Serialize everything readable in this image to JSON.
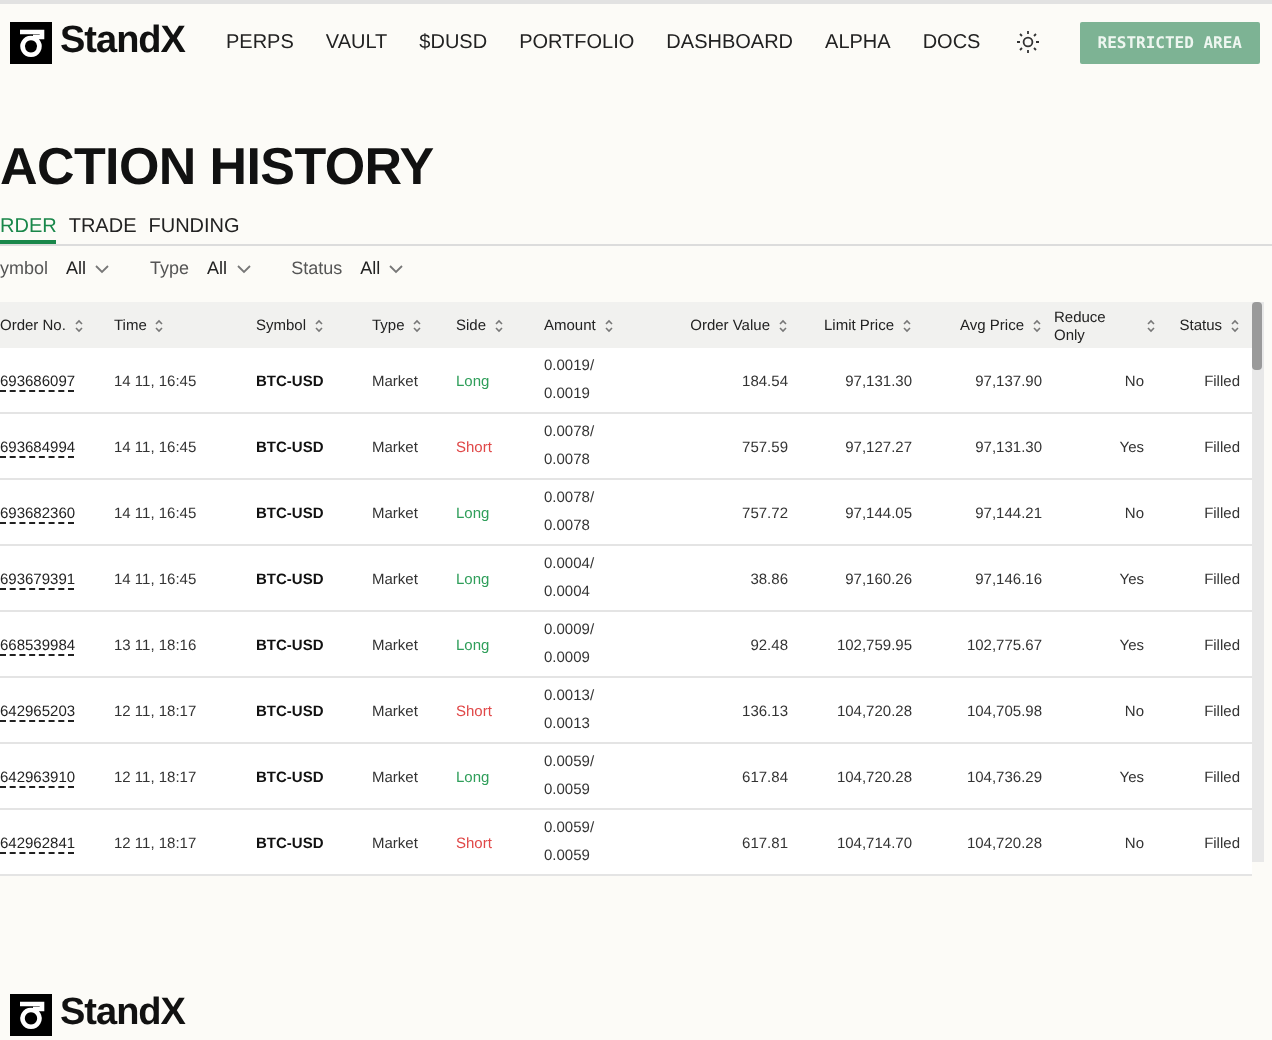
{
  "brand": {
    "name": "StandX"
  },
  "nav": [
    "PERPS",
    "VAULT",
    "$DUSD",
    "PORTFOLIO",
    "DASHBOARD",
    "ALPHA",
    "DOCS"
  ],
  "restricted_button": "RESTRICTED AREA",
  "title": "ACTION HISTORY",
  "tabs": [
    {
      "label": "RDER",
      "selected": true
    },
    {
      "label": "TRADE",
      "selected": false
    },
    {
      "label": "FUNDING",
      "selected": false
    }
  ],
  "filters": [
    {
      "label": "ymbol",
      "value": "All"
    },
    {
      "label": "Type",
      "value": "All"
    },
    {
      "label": "Status",
      "value": "All"
    }
  ],
  "table": {
    "columns": [
      "Order No.",
      "Time",
      "Symbol",
      "Type",
      "Side",
      "Amount",
      "Order Value",
      "Limit Price",
      "Avg Price",
      "Reduce Only",
      "Status"
    ],
    "rows": [
      {
        "order_no": "693686097",
        "time": "14 11, 16:45",
        "symbol": "BTC-USD",
        "type": "Market",
        "side": {
          "text": "Long",
          "kind": "long"
        },
        "amount": [
          "0.0019/",
          "0.0019"
        ],
        "order_value": "184.54",
        "limit_price": "97,131.30",
        "avg_price": "97,137.90",
        "reduce_only": "No",
        "status": "Filled"
      },
      {
        "order_no": "693684994",
        "time": "14 11, 16:45",
        "symbol": "BTC-USD",
        "type": "Market",
        "side": {
          "text": "Short",
          "kind": "short"
        },
        "amount": [
          "0.0078/",
          "0.0078"
        ],
        "order_value": "757.59",
        "limit_price": "97,127.27",
        "avg_price": "97,131.30",
        "reduce_only": "Yes",
        "status": "Filled"
      },
      {
        "order_no": "693682360",
        "time": "14 11, 16:45",
        "symbol": "BTC-USD",
        "type": "Market",
        "side": {
          "text": "Long",
          "kind": "long"
        },
        "amount": [
          "0.0078/",
          "0.0078"
        ],
        "order_value": "757.72",
        "limit_price": "97,144.05",
        "avg_price": "97,144.21",
        "reduce_only": "No",
        "status": "Filled"
      },
      {
        "order_no": "693679391",
        "time": "14 11, 16:45",
        "symbol": "BTC-USD",
        "type": "Market",
        "side": {
          "text": "Long",
          "kind": "long"
        },
        "amount": [
          "0.0004/",
          "0.0004"
        ],
        "order_value": "38.86",
        "limit_price": "97,160.26",
        "avg_price": "97,146.16",
        "reduce_only": "Yes",
        "status": "Filled"
      },
      {
        "order_no": "668539984",
        "time": "13 11, 18:16",
        "symbol": "BTC-USD",
        "type": "Market",
        "side": {
          "text": "Long",
          "kind": "long"
        },
        "amount": [
          "0.0009/",
          "0.0009"
        ],
        "order_value": "92.48",
        "limit_price": "102,759.95",
        "avg_price": "102,775.67",
        "reduce_only": "Yes",
        "status": "Filled"
      },
      {
        "order_no": "642965203",
        "time": "12 11, 18:17",
        "symbol": "BTC-USD",
        "type": "Market",
        "side": {
          "text": "Short",
          "kind": "short"
        },
        "amount": [
          "0.0013/",
          "0.0013"
        ],
        "order_value": "136.13",
        "limit_price": "104,720.28",
        "avg_price": "104,705.98",
        "reduce_only": "No",
        "status": "Filled"
      },
      {
        "order_no": "642963910",
        "time": "12 11, 18:17",
        "symbol": "BTC-USD",
        "type": "Market",
        "side": {
          "text": "Long",
          "kind": "long"
        },
        "amount": [
          "0.0059/",
          "0.0059"
        ],
        "order_value": "617.84",
        "limit_price": "104,720.28",
        "avg_price": "104,736.29",
        "reduce_only": "Yes",
        "status": "Filled"
      },
      {
        "order_no": "642962841",
        "time": "12 11, 18:17",
        "symbol": "BTC-USD",
        "type": "Market",
        "side": {
          "text": "Short",
          "kind": "short"
        },
        "amount": [
          "0.0059/",
          "0.0059"
        ],
        "order_value": "617.81",
        "limit_price": "104,714.70",
        "avg_price": "104,720.28",
        "reduce_only": "No",
        "status": "Filled"
      }
    ]
  },
  "footer": {
    "brand": "StandX"
  }
}
